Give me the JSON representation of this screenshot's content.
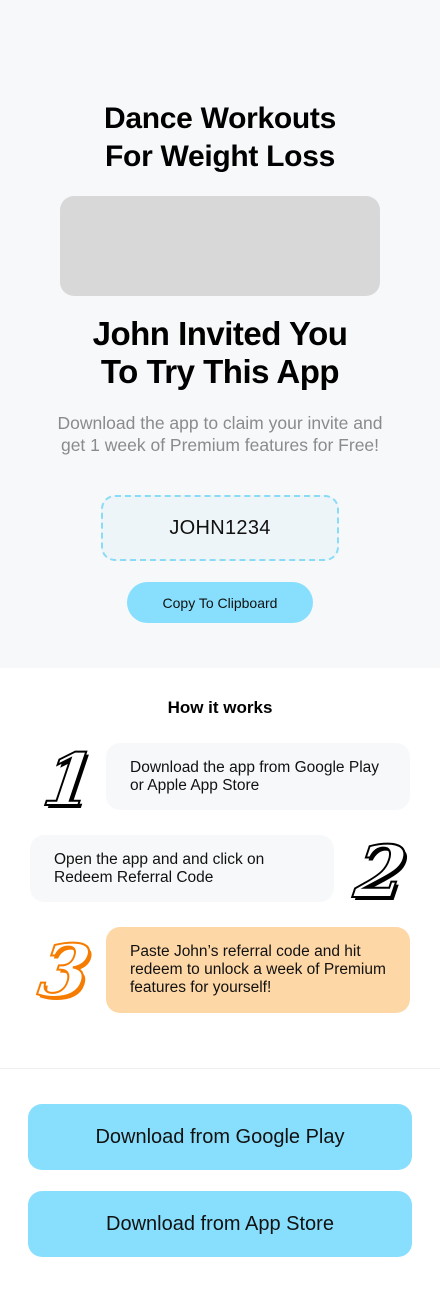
{
  "app_title": {
    "line1": "Dance Workouts",
    "line2": "For Weight Loss"
  },
  "invite": {
    "line1": "John Invited You",
    "line2": "To Try This App",
    "description": "Download the app to claim your invite and get 1 week of Premium features for Free!"
  },
  "referral": {
    "code": "JOHN1234",
    "copy_label": "Copy To Clipboard"
  },
  "how_it_works": {
    "title": "How it works",
    "steps": [
      {
        "number": "1",
        "text": "Download the app from Google Play or Apple App Store"
      },
      {
        "number": "2",
        "text": "Open the app and and click on Redeem Referral Code"
      },
      {
        "number": "3",
        "text": "Paste John’s referral code and hit redeem to unlock a week of Premium features for yourself!"
      }
    ]
  },
  "downloads": {
    "google_label": "Download from Google Play",
    "apple_label": "Download from App Store"
  },
  "colors": {
    "accent": "#87dffd",
    "highlight_step": "#fed7a6",
    "step_number_highlight": "#f57c00",
    "hero_background": "#f7f8fa"
  }
}
